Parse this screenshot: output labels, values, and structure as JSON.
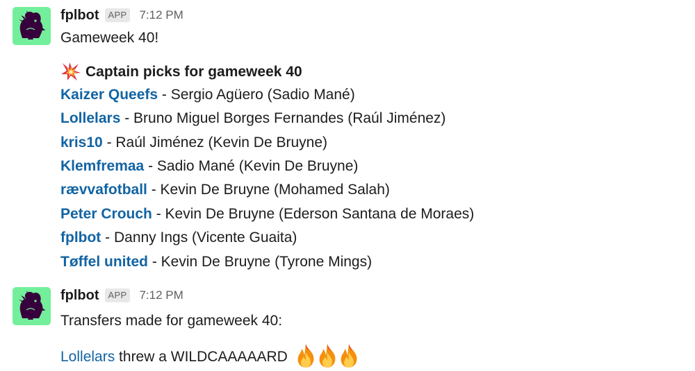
{
  "messages": [
    {
      "sender": "fplbot",
      "badge": "APP",
      "time": "7:12 PM",
      "intro": "Gameweek 40!",
      "heading_emoji": "collision-emoji",
      "heading": "Captain picks for gameweek 40",
      "picks": [
        {
          "team": "Kaizer Queefs",
          "detail": " - Sergio Agüero (Sadio Mané)"
        },
        {
          "team": "Lollelars",
          "detail": " - Bruno Miguel Borges Fernandes (Raúl Jiménez)"
        },
        {
          "team": "kris10",
          "detail": " - Raúl Jiménez (Kevin De Bruyne)"
        },
        {
          "team": "Klemfremaa",
          "detail": " - Sadio Mané (Kevin De Bruyne)"
        },
        {
          "team": "rævvafotball",
          "detail": " - Kevin De Bruyne (Mohamed Salah)"
        },
        {
          "team": "Peter Crouch",
          "detail": " - Kevin De Bruyne (Ederson Santana de Moraes)"
        },
        {
          "team": "fplbot",
          "detail": " - Danny Ings (Vicente Guaita)"
        },
        {
          "team": "Tøffel united",
          "detail": " - Kevin De Bruyne (Tyrone Mings)"
        }
      ]
    },
    {
      "sender": "fplbot",
      "badge": "APP",
      "time": "7:12 PM",
      "intro": "Transfers made for gameweek 40:",
      "transfer": {
        "team": "Lollelars",
        "text": " threw a WILDCAAAAARD",
        "emoji_icons": [
          "fire-icon",
          "fire-icon",
          "fire-icon"
        ]
      }
    }
  ],
  "colors": {
    "link": "#1264a3",
    "avatar_bg": "#73ef9b",
    "avatar_lion": "#37003c",
    "text": "#1d1c1d",
    "muted": "#616061"
  }
}
